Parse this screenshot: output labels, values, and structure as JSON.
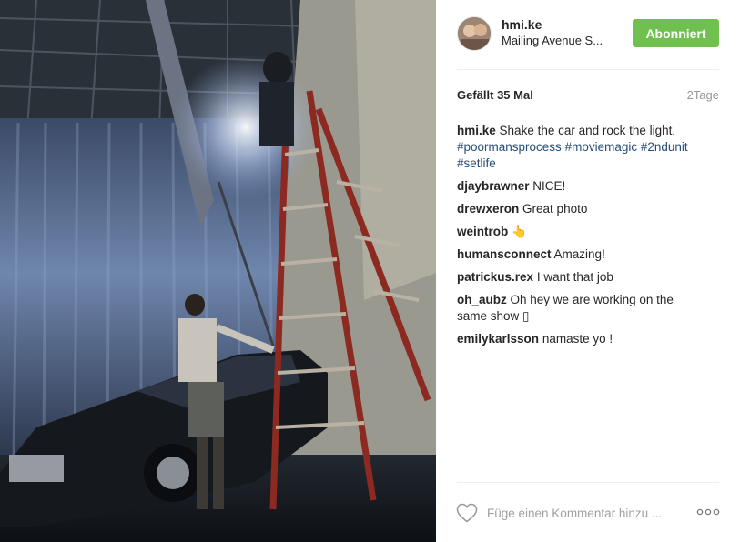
{
  "post": {
    "author": "hmi.ke",
    "location": "Mailing Avenue S...",
    "follow_label": "Abonniert",
    "likes_label": "Gefällt 35 Mal",
    "age_label": "2Tage",
    "caption": {
      "user": "hmi.ke",
      "text": "Shake the car and rock the light.",
      "hashtags": [
        "#poormansprocess",
        "#moviemagic",
        "#2ndunit",
        "#setlife"
      ]
    }
  },
  "comments": [
    {
      "user": "djaybrawner",
      "text": "NICE!"
    },
    {
      "user": "drewxeron",
      "text": "Great photo"
    },
    {
      "user": "weintrob",
      "text": "👆"
    },
    {
      "user": "humansconnect",
      "text": "Amazing!"
    },
    {
      "user": "patrickus.rex",
      "text": "I want that job"
    },
    {
      "user": "oh_aubz",
      "text": "Oh hey we are working on the same show ▯"
    },
    {
      "user": "emilykarlsson",
      "text": "namaste yo !"
    }
  ],
  "comment_input": {
    "placeholder": "Füge einen Kommentar hinzu ..."
  },
  "icons": {
    "like": "heart-outline-icon",
    "options": "more-options-icon"
  },
  "colors": {
    "follow_button": "#70c050",
    "hashtag": "#264e76",
    "muted": "#999999"
  }
}
